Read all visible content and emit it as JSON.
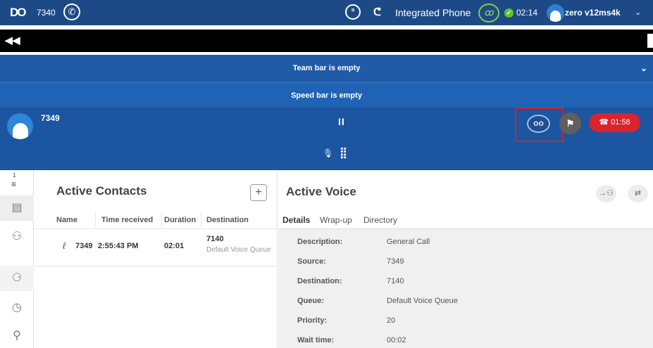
{
  "header": {
    "logo": "DO",
    "extension": "7340",
    "phone_glyph": "✆",
    "ear_glyph": "⁹",
    "integrated_icon": "ᕦ",
    "integrated_label": "Integrated Phone",
    "green_phone_glyph": "ꝏ",
    "status_check": "✓",
    "timer": "02:14",
    "user": "zero v12ms4k",
    "chevron": "⌄"
  },
  "strip": {
    "back_glyph": "◀◀"
  },
  "team_bar": {
    "label": "Team bar is empty",
    "chevron": "⌄"
  },
  "speed_bar": {
    "label": "Speed bar is empty"
  },
  "call": {
    "number": "7349",
    "pause_glyph": "II",
    "voicemail_glyph": "oo",
    "flag_glyph": "⚑",
    "hangup_time": "01:58",
    "hangup_glyph": "☎",
    "mic_glyph": "🎙",
    "keypad_glyph": "⣿"
  },
  "sidebar": {
    "list_num": "1",
    "list_lines": "≡",
    "book_glyph": "▤",
    "add_contact_glyph": "⚇",
    "team_glyph": "⚆",
    "clock_glyph": "◷",
    "search_glyph": "⚲"
  },
  "contacts": {
    "title": "Active Contacts",
    "add_label": "+",
    "columns": [
      "Name",
      "Time received",
      "Duration",
      "Destination"
    ],
    "rows": [
      {
        "name": "7349",
        "time": "2:55:43 PM",
        "duration": "02:01",
        "destination": "7140",
        "queue": "Default Voice Queue"
      }
    ]
  },
  "voice": {
    "title": "Active Voice",
    "transfer_glyph": "→⚇",
    "swap_glyph": "⇄",
    "tabs": [
      "Details",
      "Wrap-up",
      "Directory"
    ],
    "details": [
      {
        "key": "Description:",
        "value": "General Call"
      },
      {
        "key": "Source:",
        "value": "7349"
      },
      {
        "key": "Destination:",
        "value": "7140"
      },
      {
        "key": "Queue:",
        "value": "Default Voice Queue"
      },
      {
        "key": "Priority:",
        "value": "20"
      },
      {
        "key": "Wait time:",
        "value": "00:02"
      }
    ]
  },
  "colors": {
    "header_bg": "#1d4a86",
    "team_bar_bg": "#1f5ba7",
    "call_panel_bg": "#1c55a0",
    "hangup_red": "#d9232d",
    "highlight_box": "#cc2233",
    "status_green": "#5cc42b"
  }
}
